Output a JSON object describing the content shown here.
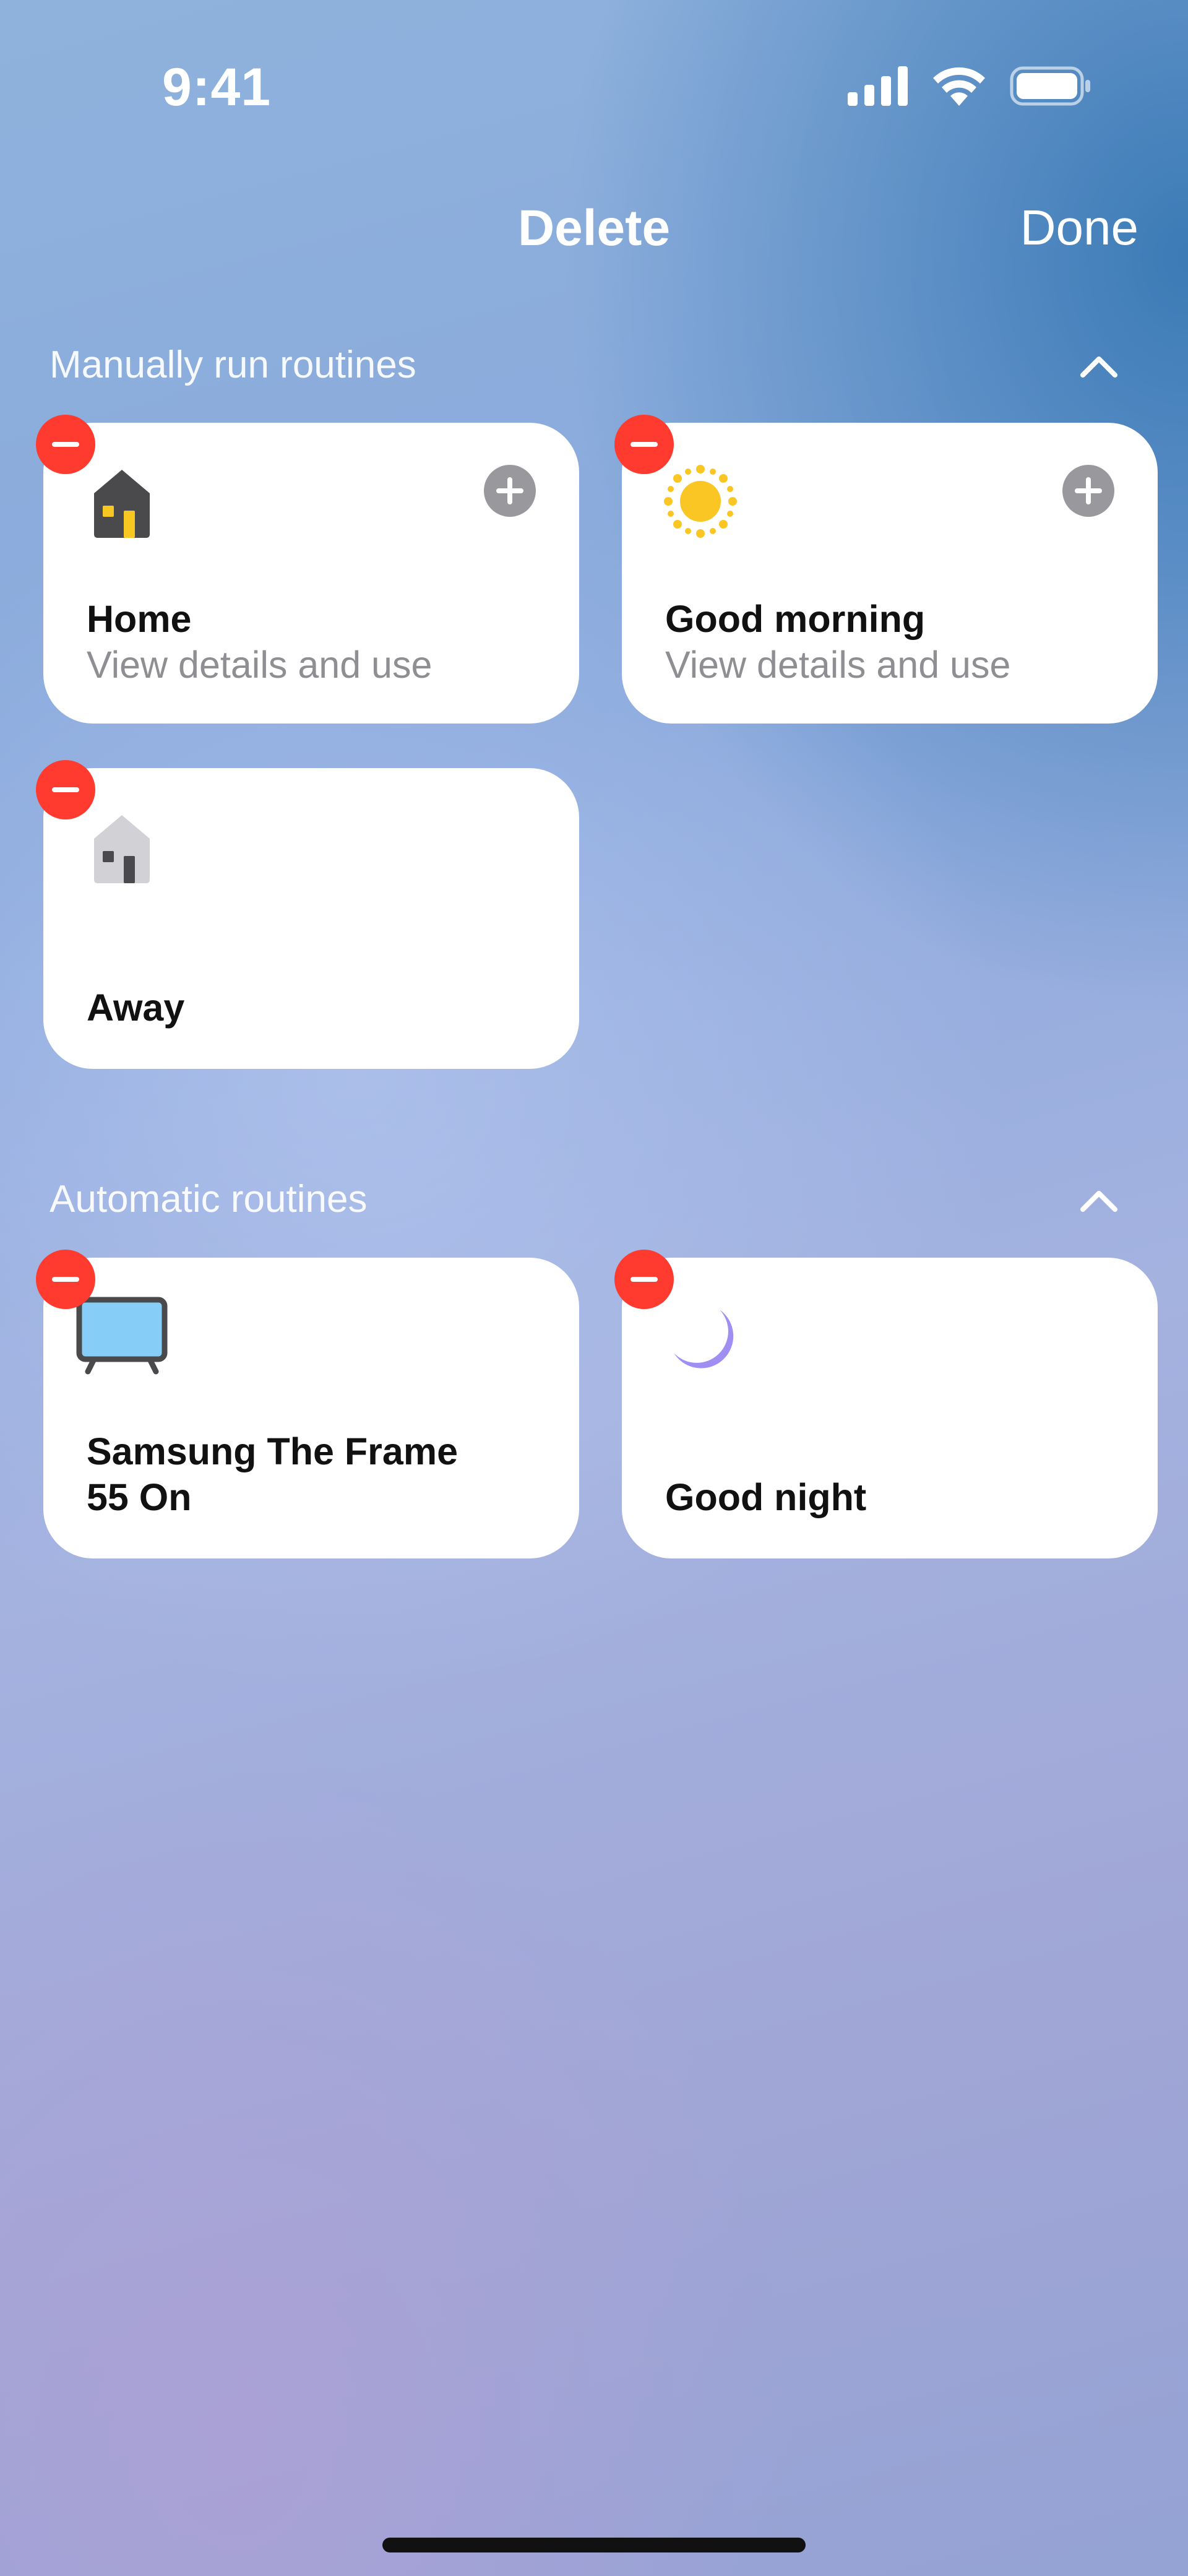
{
  "status_bar": {
    "time": "9:41",
    "icons": [
      "cellular-signal-icon",
      "wifi-icon",
      "battery-icon"
    ]
  },
  "nav": {
    "title": "Delete",
    "done_label": "Done"
  },
  "sections": [
    {
      "title": "Manually run routines",
      "collapse_icon": "chevron-up-icon",
      "cards": [
        {
          "title": "Home",
          "subtitle": "View details and use",
          "icon": "home-icon",
          "has_add_button": true
        },
        {
          "title": "Good morning",
          "subtitle": "View details and use",
          "icon": "sun-icon",
          "has_add_button": true
        },
        {
          "title": "Away",
          "icon": "away-house-icon",
          "has_add_button": false
        }
      ]
    },
    {
      "title": "Automatic routines",
      "collapse_icon": "chevron-up-icon",
      "cards": [
        {
          "title": "Samsung The Frame\n55 On",
          "icon": "tv-icon",
          "has_add_button": false
        },
        {
          "title": "Good night",
          "icon": "moon-icon",
          "has_add_button": false
        }
      ]
    }
  ],
  "colors": {
    "delete_badge": "#ff3b30",
    "add_button": "#98989d",
    "card_background": "#ffffff",
    "subtitle_text": "#8e8e93",
    "sun": "#f9c623",
    "moon": "#a08ef2",
    "tv_screen": "#86cdf8"
  }
}
